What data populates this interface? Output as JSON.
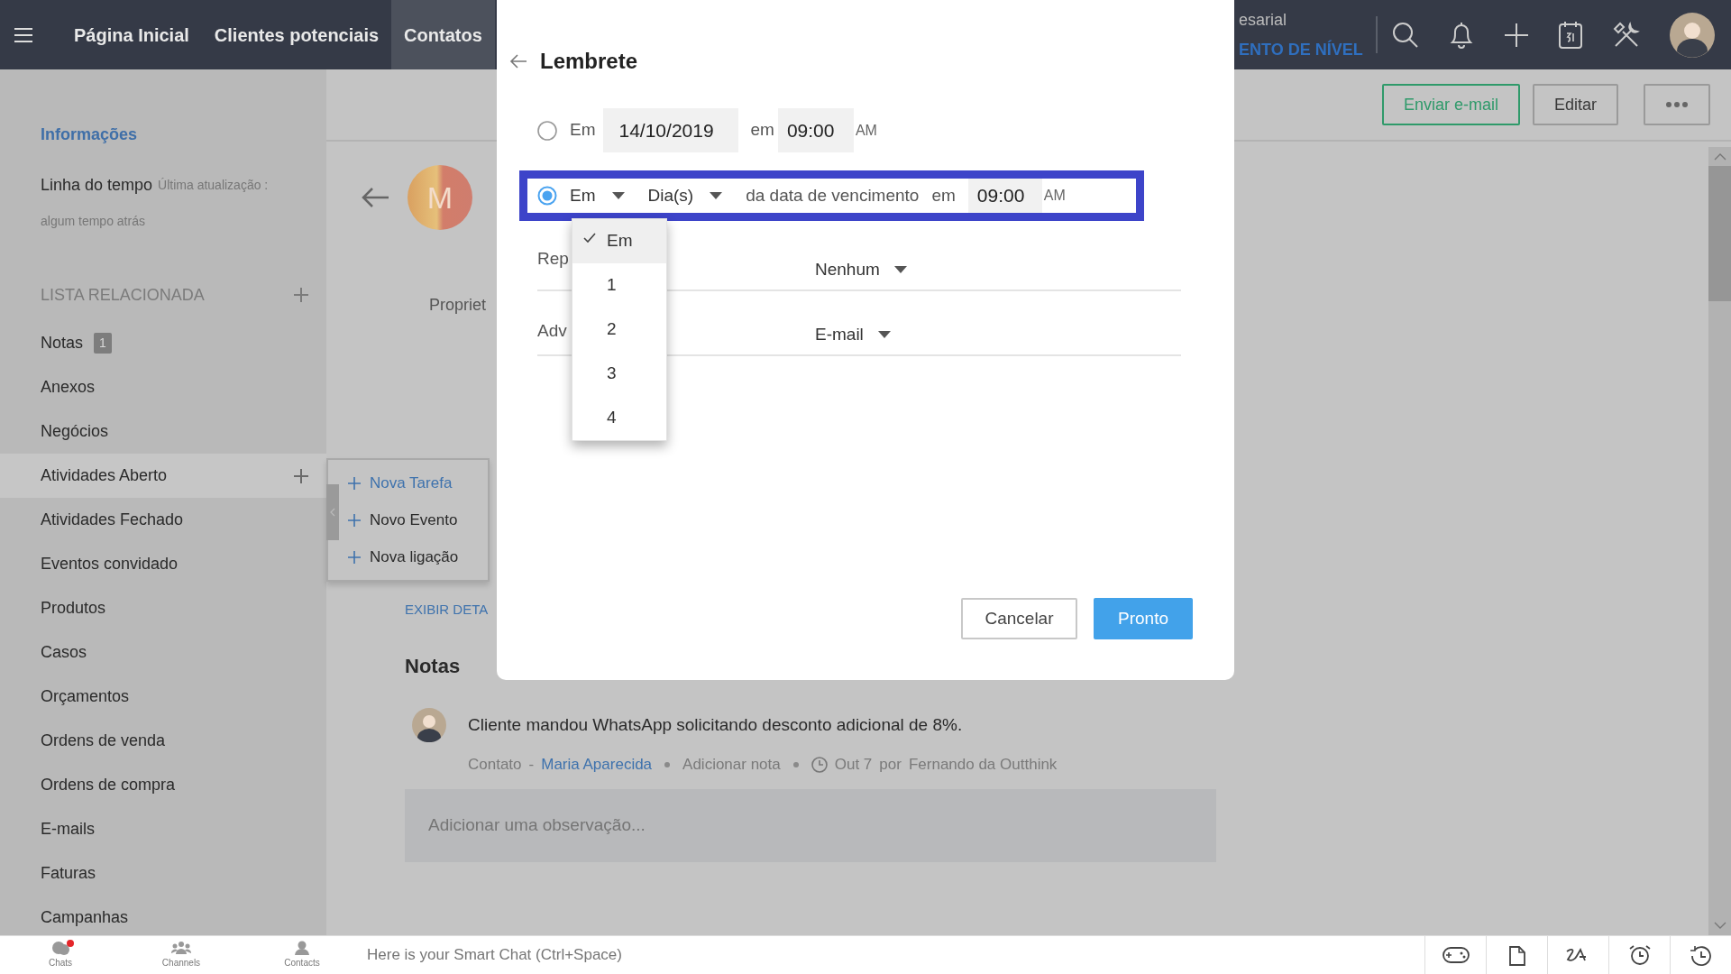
{
  "topbar": {
    "nav": [
      {
        "label": "Página Inicial",
        "selected": false
      },
      {
        "label": "Clientes potenciais",
        "selected": false
      },
      {
        "label": "Contatos",
        "selected": true
      }
    ],
    "org_name": "esarial",
    "org_level": "ENTO DE NÍVEL"
  },
  "actions": [
    {
      "label": "Enviar e-mail",
      "kind": "primary"
    },
    {
      "label": "Editar",
      "kind": "default"
    }
  ],
  "sidebar": {
    "info": "Informações",
    "timeline": "Linha do tempo",
    "updated_label": "Última atualização :",
    "updated_value": "algum tempo atrás",
    "related_heading": "LISTA RELACIONADA",
    "items": [
      {
        "label": "Notas",
        "badge": "1",
        "selected": false
      },
      {
        "label": "Anexos",
        "selected": false
      },
      {
        "label": "Negócios",
        "selected": false
      },
      {
        "label": "Atividades Aberto",
        "selected": true
      },
      {
        "label": "Atividades Fechado",
        "selected": false
      },
      {
        "label": "Eventos convidado",
        "selected": false
      },
      {
        "label": "Produtos",
        "selected": false
      },
      {
        "label": "Casos",
        "selected": false
      },
      {
        "label": "Orçamentos",
        "selected": false
      },
      {
        "label": "Ordens de venda",
        "selected": false
      },
      {
        "label": "Ordens de compra",
        "selected": false
      },
      {
        "label": "E-mails",
        "selected": false
      },
      {
        "label": "Faturas",
        "selected": false
      },
      {
        "label": "Campanhas",
        "selected": false
      }
    ]
  },
  "popover": {
    "items": [
      {
        "label": "Nova Tarefa",
        "selected": true
      },
      {
        "label": "Novo Evento",
        "selected": false
      },
      {
        "label": "Nova ligação",
        "selected": false
      }
    ]
  },
  "record": {
    "avatar_letter": "M",
    "owner_label": "Propriet",
    "details_link": "EXIBIR DETA",
    "notes_heading": "Notas",
    "note": {
      "text": "Cliente mandou WhatsApp solicitando desconto adicional de 8%.",
      "module": "Contato",
      "separator": "-",
      "contact": "Maria Aparecida",
      "add_note": "Adicionar nota",
      "date": "Out 7",
      "by": "por",
      "author": "Fernando da Outthink"
    },
    "note_input": {
      "placeholder": "Adicionar uma observação..."
    }
  },
  "modal": {
    "title": "Lembrete",
    "options": [
      {
        "kind": "date",
        "selected": false,
        "highlighted": false,
        "prefix": "Em",
        "date": "14/10/2019",
        "at": "em",
        "time": "09:00",
        "meridiem": "AM"
      },
      {
        "kind": "relative",
        "selected": true,
        "highlighted": true,
        "offset": "Em",
        "unit": "Dia(s)",
        "relation": "da data de vencimento",
        "at": "em",
        "time": "09:00",
        "meridiem": "AM"
      }
    ],
    "dropdown": {
      "items": [
        {
          "label": "Em",
          "selected": true
        },
        {
          "label": "1",
          "selected": false
        },
        {
          "label": "2",
          "selected": false
        },
        {
          "label": "3",
          "selected": false
        },
        {
          "label": "4",
          "selected": false
        }
      ]
    },
    "fields": [
      {
        "label": "Rep",
        "value": "Nenhum"
      },
      {
        "label": "Adv",
        "value": "E-mail"
      }
    ],
    "buttons": [
      {
        "label": "Cancelar",
        "kind": "secondary"
      },
      {
        "label": "Pronto",
        "kind": "primary"
      }
    ]
  },
  "bottom_bar": {
    "tabs": [
      {
        "label": "Chats",
        "notification": true
      },
      {
        "label": "Channels",
        "notification": false
      },
      {
        "label": "Contacts",
        "notification": false
      }
    ],
    "chat": {
      "placeholder": "Here is your Smart Chat (Ctrl+Space)"
    }
  }
}
